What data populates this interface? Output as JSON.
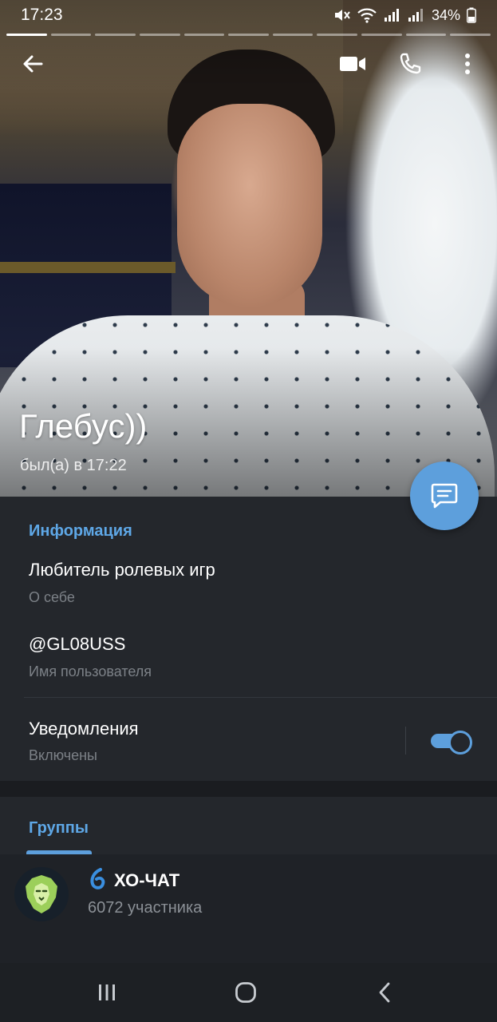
{
  "status_bar": {
    "time": "17:23",
    "battery": "34%"
  },
  "profile": {
    "name": "Глебус))",
    "last_seen": "был(а) в 17:22"
  },
  "info": {
    "header": "Информация",
    "bio_value": "Любитель ролевых игр",
    "bio_label": "О себе",
    "username_value": "@GL08USS",
    "username_label": "Имя пользователя",
    "notifications_value": "Уведомления",
    "notifications_label": "Включены",
    "notifications_enabled": true
  },
  "groups": {
    "header": "Группы",
    "items": [
      {
        "name": "ХО-ЧАТ",
        "members": "6072 участника"
      }
    ]
  },
  "icons": {
    "back": "arrow-left-icon",
    "video": "video-camera-icon",
    "call": "phone-icon",
    "more": "more-vertical-icon",
    "fab": "message-icon",
    "nav_recents": "recents-icon",
    "nav_home": "home-icon",
    "nav_back": "back-chevron-icon"
  },
  "colors": {
    "accent": "#5d9fdc",
    "section_header": "#5ea7e6",
    "background": "#24272c"
  },
  "story_progress": {
    "segments": 11,
    "active_index": 0
  }
}
